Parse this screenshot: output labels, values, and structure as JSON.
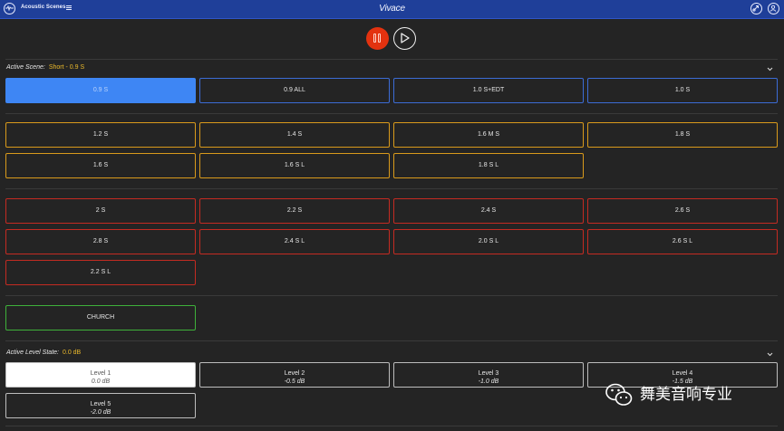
{
  "header": {
    "app_title": "Acoustic Scenes",
    "brand": "Vivace",
    "icons": [
      "app-logo-icon",
      "menu-icon",
      "link-icon",
      "user-icon"
    ]
  },
  "transport": {
    "pause_icon": "pause-icon",
    "play_icon": "play-icon"
  },
  "scene": {
    "label": "Active Scene:",
    "value": "Short - 0.9 S",
    "rows": [
      {
        "color": "blue",
        "buttons": [
          "0.9 S",
          "0.9 ALL",
          "1.0  S+EDT",
          "1.0  S"
        ]
      },
      {
        "color": "orange",
        "buttons": [
          "1.2  S",
          "1.4  S",
          "1.6 M  S",
          "1.8  S"
        ]
      },
      {
        "color": "orange",
        "buttons": [
          "1.6  S",
          "1.6 S L",
          "1.8  S L"
        ]
      },
      {
        "color": "red",
        "buttons": [
          "2  S",
          "2.2  S",
          "2.4  S",
          "2.6  S"
        ]
      },
      {
        "color": "red",
        "buttons": [
          "2.8  S",
          "2.4 S L",
          "2.0 S L",
          "2.6 S L"
        ]
      },
      {
        "color": "red",
        "buttons": [
          "2.2 S L"
        ]
      },
      {
        "color": "green",
        "buttons": [
          "CHURCH"
        ]
      }
    ]
  },
  "level": {
    "label": "Active Level State:",
    "value": "0.0 dB",
    "buttons": [
      {
        "name": "Level 1",
        "db": "0.0 dB"
      },
      {
        "name": "Level 2",
        "db": "-0.5 dB"
      },
      {
        "name": "Level 3",
        "db": "-1.0 dB"
      },
      {
        "name": "Level 4",
        "db": "-1.5 dB"
      },
      {
        "name": "Level 5",
        "db": "-2.0 dB"
      }
    ]
  },
  "watermark": {
    "text": "舞美音响专业"
  },
  "colors": {
    "topbar": "#1f3f99",
    "active_blue": "#3e86f4",
    "pause_red": "#e3320f",
    "scene_value": "#e9b82c"
  }
}
